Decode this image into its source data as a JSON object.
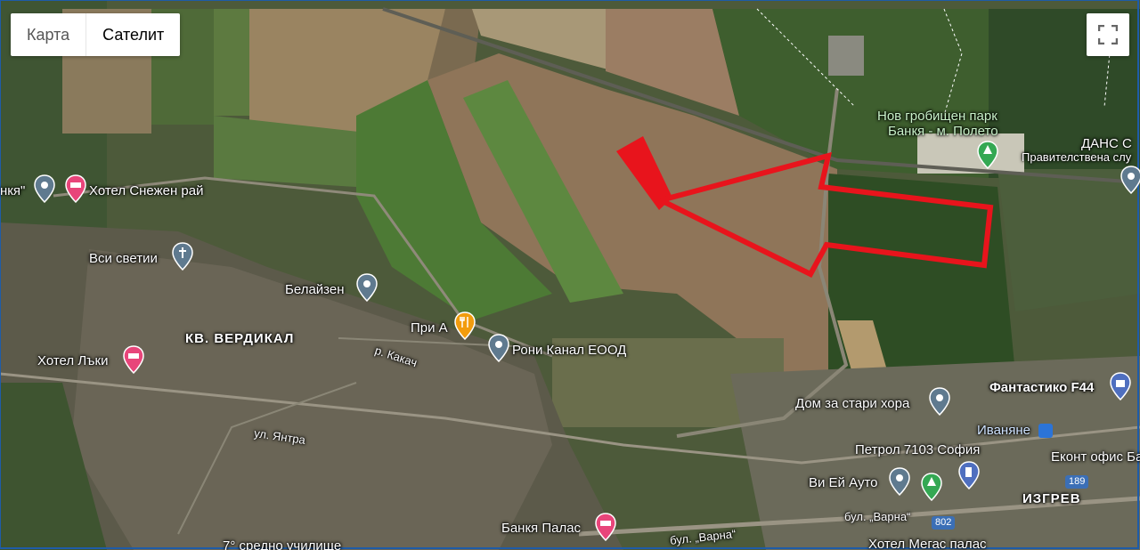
{
  "map_type_control": {
    "map_label": "Карта",
    "satellite_label": "Сателит",
    "selected": "Сателит"
  },
  "fullscreen": {
    "icon": "fullscreen-icon"
  },
  "overlay": {
    "shape": "red-outline-arrow",
    "color": "#e8141c"
  },
  "places": {
    "hotel_snezhen_rai": "Хотел Снежен рай",
    "banya_fragment": "нкя\"",
    "vsi_svetii": "Вси светии",
    "belaizen": "Белайзен",
    "pri_a": "При А",
    "roni_kanal": "Рони Канал ЕООД",
    "hotel_laki": "Хотел Лъки",
    "new_cemetery_line1": "Нов гробищен парк",
    "new_cemetery_line2": "Банкя - м. Полето",
    "dans": "ДАНС С",
    "government_service": "Правителствена слу",
    "dom_stari_hora": "Дом за стари хора",
    "fantastiko": "Фантастико F44",
    "ivanyane": "Иваняне",
    "petrol": "Петрол 7103 София",
    "ekont": "Еконт офис Бан",
    "vi_ei_auto": "Ви Ей Ауто",
    "banya_palas": "Банкя Палас",
    "hotel_megas": "Хотел Мегас палас",
    "school": "7° средно училище"
  },
  "areas": {
    "verdikal": "КВ. ВЕРДИКАЛ",
    "izgrev": "ИЗГРЕВ"
  },
  "streets": {
    "kakach": "р. Какач",
    "yantra": "ул. Янтра",
    "varna_1": "бул. „Варна“",
    "varna_2": "бул. „Варна“"
  },
  "road_shields": {
    "r189": "189",
    "r802": "802"
  },
  "colors": {
    "hotel_pin": "#e8457a",
    "generic_pin": "#5f7a8f",
    "food_pin": "#f29c0d",
    "park_pin": "#34a853",
    "gas_pin": "#4f6fbf",
    "church_pin": "#5f7a8f"
  }
}
